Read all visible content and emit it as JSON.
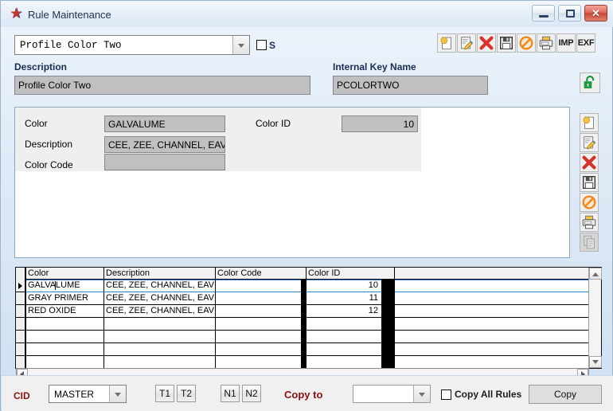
{
  "window": {
    "title": "Rule Maintenance",
    "logo_icon": "star-app-logo",
    "minimize_label": "–",
    "maximize_label": "□",
    "close_label": "✕"
  },
  "header": {
    "rule_select_value": "Profile Color Two",
    "s_checkbox_label": "S",
    "s_checkbox_checked": false,
    "description_label": "Description",
    "description_value": "Profile Color Two",
    "internal_key_label": "Internal Key Name",
    "internal_key_value": "PCOLORTWO",
    "lock_icon": "unlock-icon"
  },
  "toolbar": {
    "buttons": [
      {
        "name": "new-record-button",
        "icon": "new-document-icon",
        "label": ""
      },
      {
        "name": "edit-record-button",
        "icon": "edit-pencil-icon",
        "label": ""
      },
      {
        "name": "delete-record-button",
        "icon": "delete-x-icon",
        "label": ""
      },
      {
        "name": "save-record-button",
        "icon": "save-floppy-icon",
        "label": ""
      },
      {
        "name": "cancel-record-button",
        "icon": "cancel-prohibited-icon",
        "label": ""
      },
      {
        "name": "print-button",
        "icon": "printer-icon",
        "label": ""
      },
      {
        "name": "import-button",
        "icon": "text-label",
        "label": "IMP"
      },
      {
        "name": "export-button",
        "icon": "text-label",
        "label": "EXF"
      }
    ]
  },
  "side_toolbar": {
    "buttons": [
      {
        "name": "detail-new-button",
        "icon": "new-document-icon"
      },
      {
        "name": "detail-edit-button",
        "icon": "edit-pencil-icon"
      },
      {
        "name": "detail-delete-button",
        "icon": "delete-x-icon"
      },
      {
        "name": "detail-save-button",
        "icon": "save-floppy-icon"
      },
      {
        "name": "detail-cancel-button",
        "icon": "cancel-prohibited-icon"
      },
      {
        "name": "detail-print-button",
        "icon": "printer-icon"
      },
      {
        "name": "detail-copy-button",
        "icon": "copy-icon-disabled"
      }
    ]
  },
  "detail": {
    "color_label": "Color",
    "color_value": "GALVALUME",
    "description_label": "Description",
    "description_value": "CEE, ZEE, CHANNEL, EAV",
    "color_code_label": "Color Code",
    "color_code_value": "",
    "color_id_label": "Color ID",
    "color_id_value": "10"
  },
  "grid": {
    "columns": [
      "Color",
      "Description",
      "Color Code",
      "Color ID"
    ],
    "rows": [
      {
        "color": "GALVALUME",
        "description": "CEE, ZEE, CHANNEL, EAVE",
        "color_code": "",
        "color_id": "10",
        "selected": true
      },
      {
        "color": "GRAY PRIMER",
        "description": "CEE, ZEE, CHANNEL, EAVE",
        "color_code": "",
        "color_id": "11",
        "selected": false
      },
      {
        "color": "RED OXIDE",
        "description": "CEE, ZEE, CHANNEL, EAVE",
        "color_code": "",
        "color_id": "12",
        "selected": false
      },
      {
        "color": "",
        "description": "",
        "color_code": "",
        "color_id": "",
        "selected": false
      },
      {
        "color": "",
        "description": "",
        "color_code": "",
        "color_id": "",
        "selected": false
      },
      {
        "color": "",
        "description": "",
        "color_code": "",
        "color_id": "",
        "selected": false
      },
      {
        "color": "",
        "description": "",
        "color_code": "",
        "color_id": "",
        "selected": false
      }
    ],
    "scroll_up_icon": "scroll-up-arrow",
    "scroll_down_icon": "scroll-down-arrow",
    "scroll_left_icon": "scroll-left-arrow",
    "scroll_right_icon": "scroll-right-arrow"
  },
  "footer": {
    "cid_label": "CID",
    "cid_value": "MASTER",
    "t1_label": "T1",
    "t2_label": "T2",
    "n1_label": "N1",
    "n2_label": "N2",
    "copy_to_label": "Copy to",
    "copy_to_value": "",
    "copy_all_label": "Copy All Rules",
    "copy_all_checked": false,
    "copy_button_label": "Copy"
  },
  "colors": {
    "accent_blue": "#2d7fd0",
    "label_red": "#8b1010",
    "label_navy": "#172d52",
    "field_gray": "#c0c0c0",
    "unlock_green": "#1a9a3c",
    "close_red": "#c94634"
  }
}
